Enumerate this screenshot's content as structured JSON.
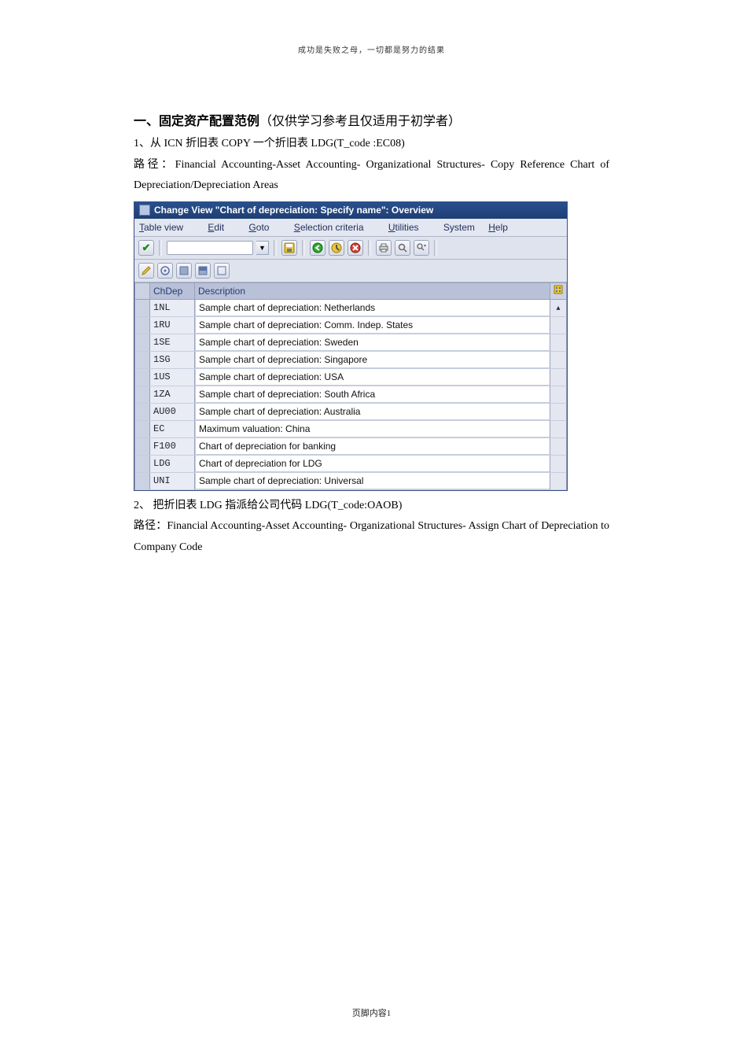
{
  "top_motto": "成功是失败之母，一切都是努力的结果",
  "heading_bold": "一、固定资产配置范例",
  "heading_paren": "（仅供学习参考且仅适用于初学者）",
  "step1_text": "1、从 ICN 折旧表 COPY 一个折旧表 LDG(T_code :EC08)",
  "step1_path": "路径：Financial Accounting-Asset Accounting- Organizational Structures- Copy Reference Chart of Depreciation/Depreciation Areas",
  "sap": {
    "title": "Change View \"Chart of depreciation: Specify name\": Overview",
    "menu": {
      "tableview": "Table view",
      "edit": "Edit",
      "goto": "Goto",
      "selection": "Selection criteria",
      "utilities": "Utilities",
      "system": "System",
      "help": "Help"
    },
    "headers": {
      "chdep": "ChDep",
      "description": "Description"
    },
    "rows": [
      {
        "code": "1NL",
        "desc": "Sample chart of depreciation: Netherlands"
      },
      {
        "code": "1RU",
        "desc": "Sample chart of depreciation: Comm. Indep. States"
      },
      {
        "code": "1SE",
        "desc": "Sample chart of depreciation: Sweden"
      },
      {
        "code": "1SG",
        "desc": "Sample chart of depreciation: Singapore"
      },
      {
        "code": "1US",
        "desc": "Sample chart of depreciation: USA"
      },
      {
        "code": "1ZA",
        "desc": "Sample chart of depreciation: South Africa"
      },
      {
        "code": "AU00",
        "desc": "Sample chart of depreciation: Australia"
      },
      {
        "code": "EC",
        "desc": "Maximum valuation: China"
      },
      {
        "code": "F100",
        "desc": "Chart of depreciation for banking"
      },
      {
        "code": "LDG",
        "desc": "Chart of depreciation for LDG"
      },
      {
        "code": "UNI",
        "desc": "Sample chart of depreciation: Universal"
      }
    ]
  },
  "step2_text": "2、 把折旧表 LDG 指派给公司代码 LDG(T_code:OAOB)",
  "step2_path": "路径：Financial Accounting-Asset Accounting- Organizational Structures- Assign Chart of Depreciation to Company Code",
  "footer_label": "页脚内容",
  "footer_page": "1"
}
